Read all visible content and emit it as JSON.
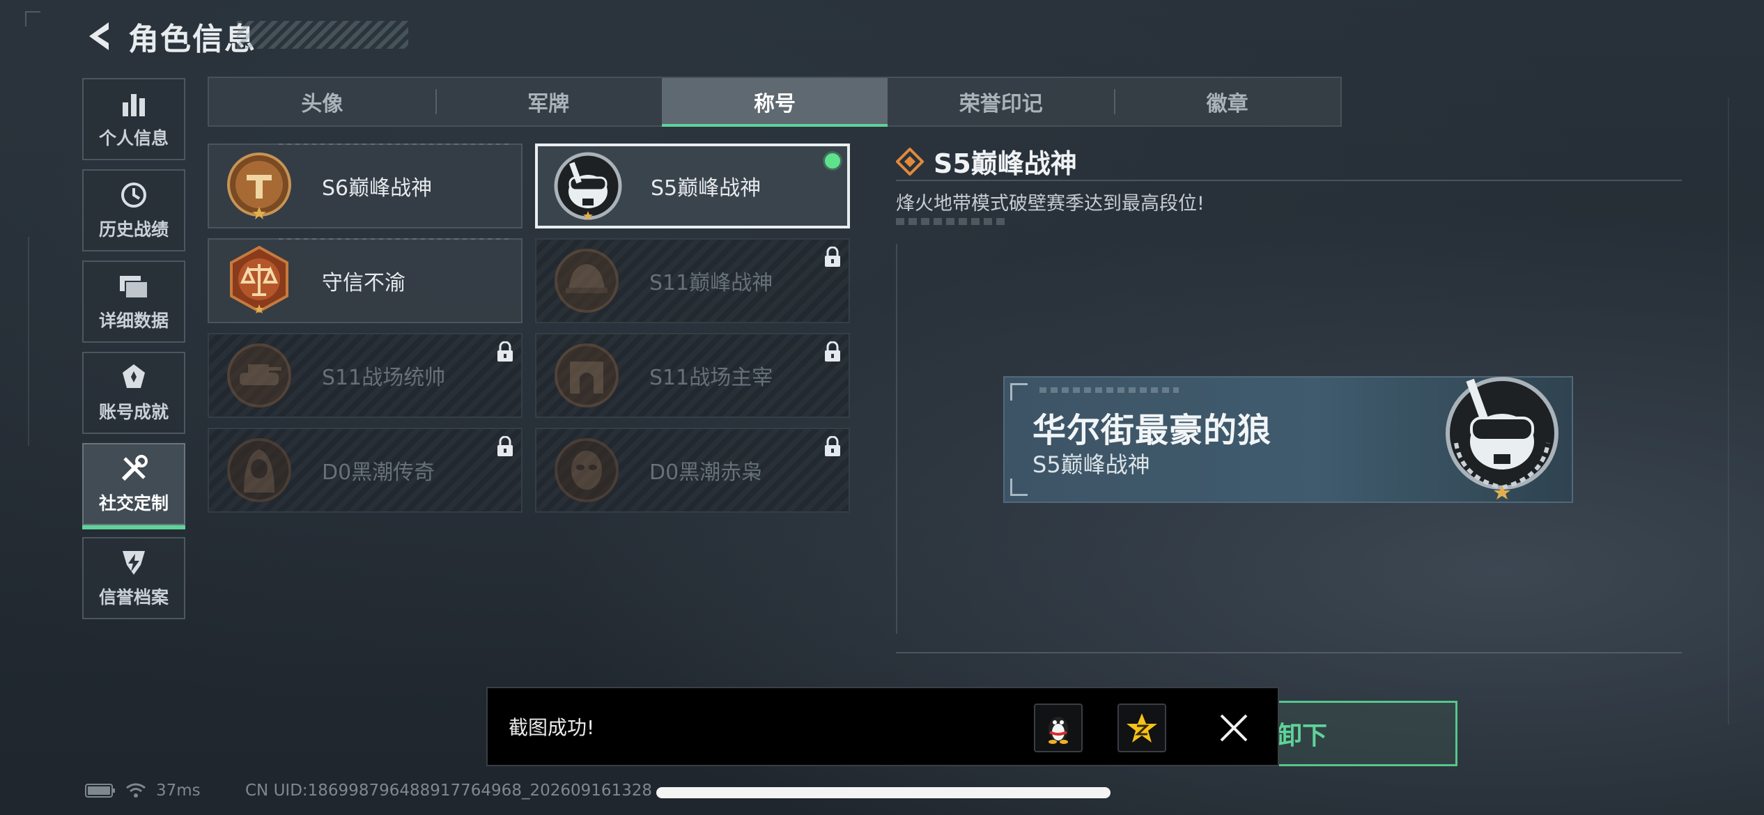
{
  "header": {
    "title": "角色信息"
  },
  "sidebar": {
    "items": [
      {
        "label": "个人信息",
        "icon": "bar-chart-icon"
      },
      {
        "label": "历史战绩",
        "icon": "clock-history-icon"
      },
      {
        "label": "详细数据",
        "icon": "folder-icon"
      },
      {
        "label": "账号成就",
        "icon": "achievement-icon"
      },
      {
        "label": "社交定制",
        "icon": "tools-icon",
        "active": true
      },
      {
        "label": "信誉档案",
        "icon": "shield-lightning-icon"
      }
    ]
  },
  "tabs": [
    {
      "label": "头像"
    },
    {
      "label": "军牌"
    },
    {
      "label": "称号",
      "active": true
    },
    {
      "label": "荣誉印记"
    },
    {
      "label": "徽章"
    }
  ],
  "titles": [
    {
      "name": "S6巅峰战神",
      "locked": false,
      "selected": false,
      "icon": "emblem-t-badge-icon"
    },
    {
      "name": "S5巅峰战神",
      "locked": false,
      "selected": true,
      "equipped": true,
      "icon": "skull-goggles-badge-icon"
    },
    {
      "name": "守信不渝",
      "locked": false,
      "selected": false,
      "icon": "scales-badge-icon"
    },
    {
      "name": "S11巅峰战神",
      "locked": true,
      "selected": false,
      "icon": "helmet-badge-icon"
    },
    {
      "name": "S11战场统帅",
      "locked": true,
      "selected": false,
      "icon": "tank-badge-icon"
    },
    {
      "name": "S11战场主宰",
      "locked": true,
      "selected": false,
      "icon": "arch-badge-icon"
    },
    {
      "name": "D0黑潮传奇",
      "locked": true,
      "selected": false,
      "icon": "hooded-figure-badge-icon"
    },
    {
      "name": "D0黑潮赤枭",
      "locked": true,
      "selected": false,
      "icon": "masked-face-badge-icon"
    }
  ],
  "detail": {
    "title": "S5巅峰战神",
    "description": "烽火地带模式破壁赛季达到最高段位!"
  },
  "preview": {
    "player_name": "华尔街最豪的狼",
    "title": "S5巅峰战神"
  },
  "equip_button": {
    "visible_label": "卸下"
  },
  "toast": {
    "message": "截图成功!",
    "share_qq_icon": "qq-penguin-icon",
    "share_zone_icon": "qzone-star-icon"
  },
  "status": {
    "ping": "37ms",
    "uid": "CN UID:1869987964889177649​68_202609161328"
  },
  "colors": {
    "accent": "#5ed39a",
    "bronze": "#b07a44",
    "equipped_dot": "#5ee38c"
  }
}
